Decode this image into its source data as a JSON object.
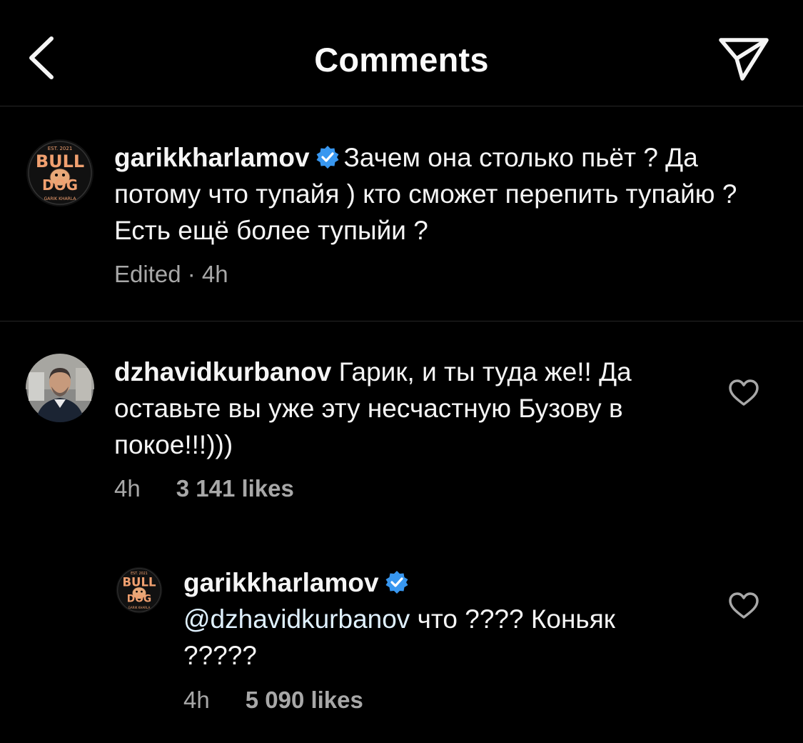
{
  "header": {
    "title": "Comments",
    "back_icon": "chevron-left-icon",
    "share_icon": "paper-plane-icon"
  },
  "caption": {
    "username": "garikkharlamov",
    "verified": true,
    "text": "Зачем она столько пьёт ? Да потому что тупайя ) кто сможет перепить тупайю ? Есть ещё более тупыйи ?",
    "meta": "Edited · 4h",
    "avatar_lines": [
      "EST. 2021",
      "BULL",
      "DOG",
      "GARIK KHARLA"
    ]
  },
  "comments": [
    {
      "username": "dzhavidkurbanov",
      "verified": false,
      "text": "Гарик, и ты туда же!! Да оставьте вы уже эту несчастную Бузову в покое!!!)))",
      "time": "4h",
      "likes": "3 141 likes"
    },
    {
      "username": "garikkharlamov",
      "verified": true,
      "mention": "@dzhavidkurbanov",
      "text": " что ???? Коньяк ?????",
      "time": "4h",
      "likes": "5 090 likes"
    }
  ],
  "colors": {
    "background": "#000000",
    "text": "#f5f5f5",
    "secondary": "#a8a8a8",
    "verified": "#3897f0",
    "mention": "#e0f1ff",
    "divider": "#262626",
    "logo_orange": "#f0a070"
  }
}
